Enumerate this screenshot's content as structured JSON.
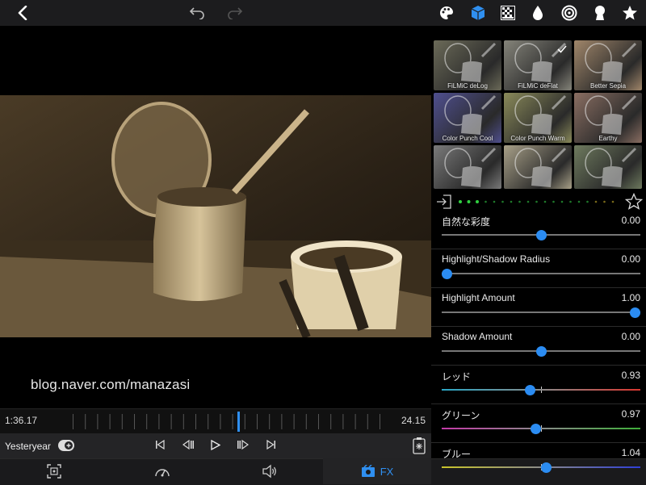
{
  "topbar": {
    "back_icon": "chevron-left-icon",
    "undo_icon": "undo-icon",
    "redo_icon": "redo-icon",
    "tools": [
      "palette-icon",
      "cube-icon",
      "checker-icon",
      "drop-icon",
      "spiral-icon",
      "keyhole-icon",
      "star-icon"
    ],
    "active_tool": "cube-icon",
    "accent": "#2f8ff0"
  },
  "video": {
    "watermark": "blog.naver.com/manazasi"
  },
  "timeline": {
    "current_time": "1:36.17",
    "end_time": "24.15"
  },
  "transport": {
    "look_name": "Yesteryear"
  },
  "tabs": {
    "fx_label": "FX",
    "active": "FX"
  },
  "filters": [
    {
      "label": "FiLMiC deLog",
      "tint": "#6b6a58",
      "selected": false
    },
    {
      "label": "FiLMiC deFlat",
      "tint": "#85847a",
      "selected": true
    },
    {
      "label": "Better Sepia",
      "tint": "#a0866a",
      "selected": false
    },
    {
      "label": "Color Punch Cool",
      "tint": "#4f4f8f",
      "selected": false
    },
    {
      "label": "Color Punch Warm",
      "tint": "#8a8a5a",
      "selected": false
    },
    {
      "label": "Earthy",
      "tint": "#8a6e62",
      "selected": false
    },
    {
      "label": "",
      "tint": "#7a7a7a",
      "selected": false
    },
    {
      "label": "",
      "tint": "#a8a088",
      "selected": false
    },
    {
      "label": "",
      "tint": "#6e7a5e",
      "selected": false
    }
  ],
  "controls": [
    {
      "label": "自然な彩度",
      "value": "0.00",
      "level": 0.5,
      "track": "#777",
      "center": false
    },
    {
      "label": "Highlight/Shadow Radius",
      "value": "0.00",
      "level": 0.0,
      "track": "#777",
      "center": false
    },
    {
      "label": "Highlight Amount",
      "value": "1.00",
      "level": 1.0,
      "track": "#777",
      "center": false
    },
    {
      "label": "Shadow Amount",
      "value": "0.00",
      "level": 0.5,
      "track": "#777",
      "center": false
    },
    {
      "label": "レッド",
      "value": "0.93",
      "level": 0.44,
      "track": "gradient-red",
      "center": true
    },
    {
      "label": "グリーン",
      "value": "0.97",
      "level": 0.47,
      "track": "gradient-green",
      "center": true
    },
    {
      "label": "ブルー",
      "value": "1.04",
      "level": 0.53,
      "track": "gradient-blue",
      "center": true
    }
  ]
}
